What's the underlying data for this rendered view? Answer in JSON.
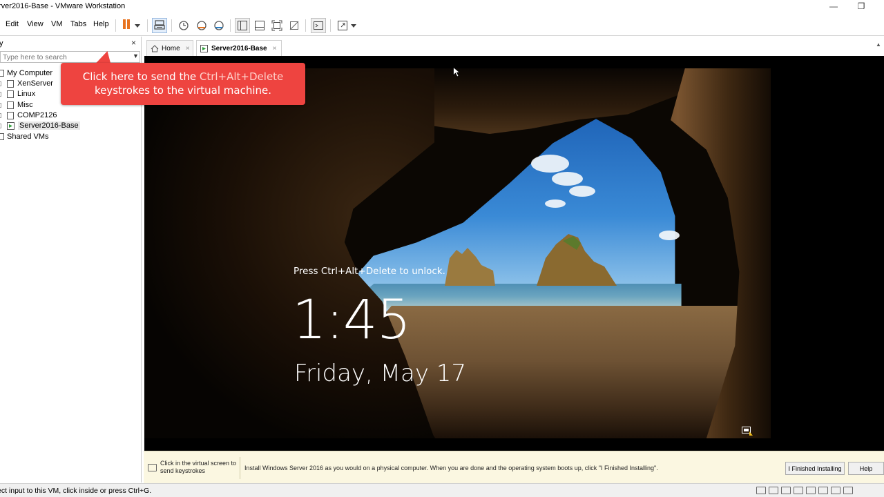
{
  "window": {
    "title": "rver2016-Base - VMware Workstation",
    "minimize_glyph": "—",
    "maximize_glyph": "❐"
  },
  "menu": {
    "items": [
      "Edit",
      "View",
      "VM",
      "Tabs",
      "Help"
    ]
  },
  "toolbar": {
    "icons": [
      "pause-icon",
      "dropdown-icon",
      "send-ctrl-alt-del-icon",
      "snapshot-icon",
      "revert-snapshot-icon",
      "snapshot-manager-icon",
      "show-library-icon",
      "thumbnail-bar-icon",
      "full-screen-icon",
      "unity-icon",
      "console-view-icon",
      "stretch-guest-icon"
    ]
  },
  "library": {
    "title": "y",
    "close_glyph": "×",
    "search_placeholder": "Type here to search",
    "tree": [
      {
        "label": "My Computer",
        "type": "group"
      },
      {
        "label": "XenServer",
        "type": "vm"
      },
      {
        "label": "Linux",
        "type": "vm"
      },
      {
        "label": "Misc",
        "type": "vm"
      },
      {
        "label": "COMP2126",
        "type": "vm"
      },
      {
        "label": "Server2016-Base",
        "type": "vm-running",
        "selected": true
      },
      {
        "label": "Shared VMs",
        "type": "group"
      }
    ]
  },
  "tabs": [
    {
      "label": "Home",
      "active": false,
      "close": "×"
    },
    {
      "label": "Server2016-Base",
      "active": true,
      "close": "×"
    }
  ],
  "callout": {
    "line1_prefix": "Click here to send the ",
    "line1_highlight": "Ctrl+Alt+Delete",
    "line2": "keystrokes to the virtual machine.",
    "color": "#ee4440"
  },
  "lockscreen": {
    "hint": "Press Ctrl+Alt+Delete to unlock.",
    "time": "1:45",
    "date": "Friday, May 17"
  },
  "hintbar": {
    "left_text": "Click in the virtual screen to send keystrokes",
    "message": "Install Windows Server 2016 as you would on a physical computer. When you are done and the operating system boots up, click \"I Finished Installing\".",
    "finished_button": "I Finished Installing",
    "help_button": "Help"
  },
  "statusbar": {
    "text": "ect input to this VM, click inside or press Ctrl+G."
  }
}
